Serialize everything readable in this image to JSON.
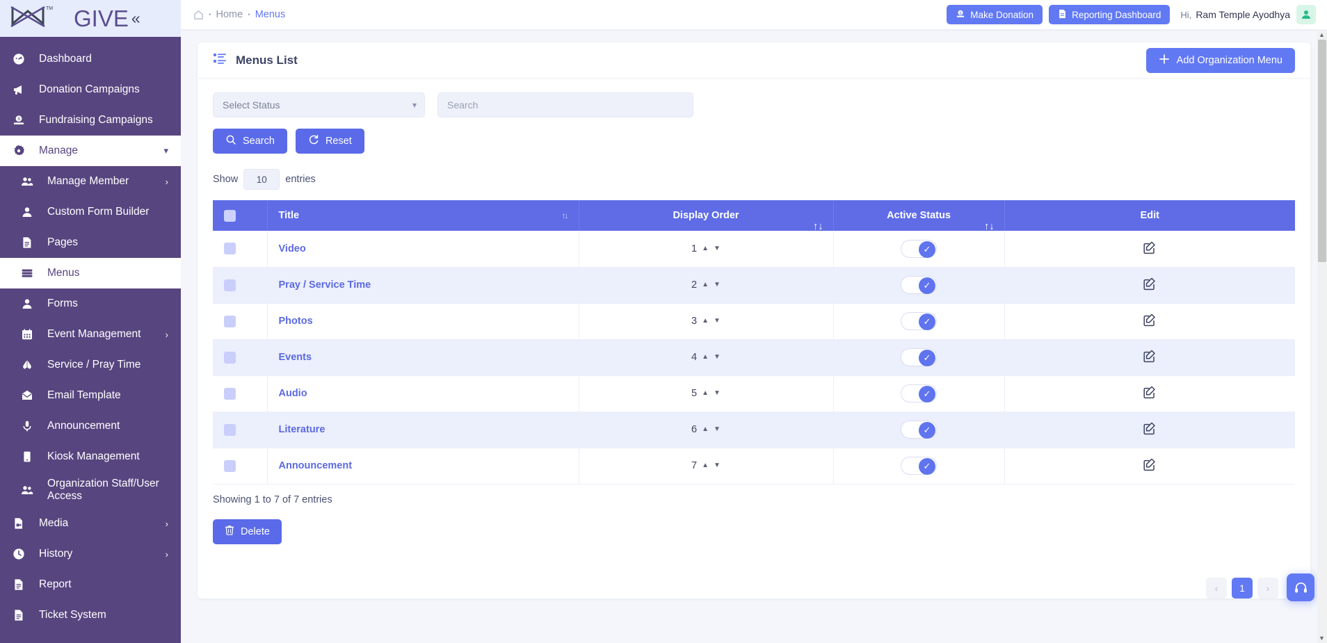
{
  "brand": {
    "name": "GIVE",
    "collapse_icon": "chevron-double-left-icon"
  },
  "sidebar": {
    "items": [
      {
        "label": "Dashboard",
        "icon": "speedometer-icon",
        "active": false,
        "sub": false,
        "chevron": ""
      },
      {
        "label": "Donation Campaigns",
        "icon": "megaphone-icon",
        "active": false,
        "sub": false,
        "chevron": ""
      },
      {
        "label": "Fundraising Campaigns",
        "icon": "money-icon",
        "active": false,
        "sub": false,
        "chevron": ""
      },
      {
        "label": "Manage",
        "icon": "gear-icon",
        "active": true,
        "sub": false,
        "chevron": "chevron-down-icon"
      },
      {
        "label": "Manage Member",
        "icon": "users-icon",
        "active": false,
        "sub": true,
        "chevron": "chevron-right-icon"
      },
      {
        "label": "Custom Form Builder",
        "icon": "user-icon",
        "active": false,
        "sub": true,
        "chevron": ""
      },
      {
        "label": "Pages",
        "icon": "file-icon",
        "active": false,
        "sub": true,
        "chevron": ""
      },
      {
        "label": "Menus",
        "icon": "list-icon",
        "active": true,
        "sub": true,
        "chevron": ""
      },
      {
        "label": "Forms",
        "icon": "user-icon",
        "active": false,
        "sub": true,
        "chevron": ""
      },
      {
        "label": "Event Management",
        "icon": "calendar-icon",
        "active": false,
        "sub": true,
        "chevron": "chevron-right-icon"
      },
      {
        "label": "Service / Pray Time",
        "icon": "praying-hands-icon",
        "active": false,
        "sub": true,
        "chevron": ""
      },
      {
        "label": "Email Template",
        "icon": "envelope-icon",
        "active": false,
        "sub": true,
        "chevron": ""
      },
      {
        "label": "Announcement",
        "icon": "microphone-icon",
        "active": false,
        "sub": true,
        "chevron": ""
      },
      {
        "label": "Kiosk Management",
        "icon": "tablet-icon",
        "active": false,
        "sub": true,
        "chevron": ""
      },
      {
        "label": "Organization Staff/User Access",
        "icon": "users-icon",
        "active": false,
        "sub": true,
        "chevron": ""
      },
      {
        "label": "Media",
        "icon": "file-video-icon",
        "active": false,
        "sub": false,
        "chevron": "chevron-right-icon"
      },
      {
        "label": "History",
        "icon": "clock-icon",
        "active": false,
        "sub": false,
        "chevron": "chevron-right-icon"
      },
      {
        "label": "Report",
        "icon": "file-text-icon",
        "active": false,
        "sub": false,
        "chevron": ""
      },
      {
        "label": "Ticket System",
        "icon": "file-text-icon",
        "active": false,
        "sub": false,
        "chevron": ""
      }
    ]
  },
  "topbar": {
    "breadcrumb": {
      "home_icon": "home-icon",
      "home": "Home",
      "current": "Menus"
    },
    "make_donation_label": "Make Donation",
    "reporting_dashboard_label": "Reporting Dashboard",
    "greeting_prefix": "Hi,",
    "user_name": "Ram Temple Ayodhya",
    "avatar_icon": "user-icon"
  },
  "page": {
    "title": "Menus List",
    "title_icon": "list-detail-icon",
    "add_button_label": "Add Organization Menu",
    "add_button_icon": "plus-icon"
  },
  "filters": {
    "status_selected": "Select Status",
    "status_options": [
      "Select Status"
    ],
    "search_placeholder": "Search",
    "search_value": "",
    "search_button_label": "Search",
    "search_button_icon": "search-icon",
    "reset_button_label": "Reset",
    "reset_button_icon": "refresh-icon"
  },
  "table_controls": {
    "show_label": "Show",
    "entries_value": "10",
    "entries_label": "entries"
  },
  "table": {
    "columns": [
      {
        "label": "",
        "sortable": false,
        "name": "select-all"
      },
      {
        "label": "Title",
        "sortable": true,
        "name": "title"
      },
      {
        "label": "Display Order",
        "sortable": true,
        "name": "display-order"
      },
      {
        "label": "Active Status",
        "sortable": true,
        "name": "active-status"
      },
      {
        "label": "Edit",
        "sortable": false,
        "name": "edit"
      }
    ],
    "rows": [
      {
        "title": "Video",
        "order": "1",
        "active": true,
        "edit_icon": "edit-square-icon"
      },
      {
        "title": "Pray / Service Time",
        "order": "2",
        "active": true,
        "edit_icon": "edit-square-icon"
      },
      {
        "title": "Photos",
        "order": "3",
        "active": true,
        "edit_icon": "edit-square-icon"
      },
      {
        "title": "Events",
        "order": "4",
        "active": true,
        "edit_icon": "edit-square-icon"
      },
      {
        "title": "Audio",
        "order": "5",
        "active": true,
        "edit_icon": "edit-square-icon"
      },
      {
        "title": "Literature",
        "order": "6",
        "active": true,
        "edit_icon": "edit-square-icon"
      },
      {
        "title": "Announcement",
        "order": "7",
        "active": true,
        "edit_icon": "edit-square-icon"
      }
    ]
  },
  "footer": {
    "showing_text": "Showing 1 to 7 of 7 entries",
    "delete_label": "Delete",
    "delete_icon": "trash-icon",
    "pagination": {
      "prev": "‹",
      "pages": [
        "1"
      ],
      "current": "1",
      "next": "›"
    },
    "support_icon": "headset-icon"
  },
  "colors": {
    "sidebar_bg": "#57457f",
    "primary": "#6279f4",
    "table_header": "#5f6ce6",
    "link": "#5b6ae0",
    "row_alt": "#eceffc"
  }
}
